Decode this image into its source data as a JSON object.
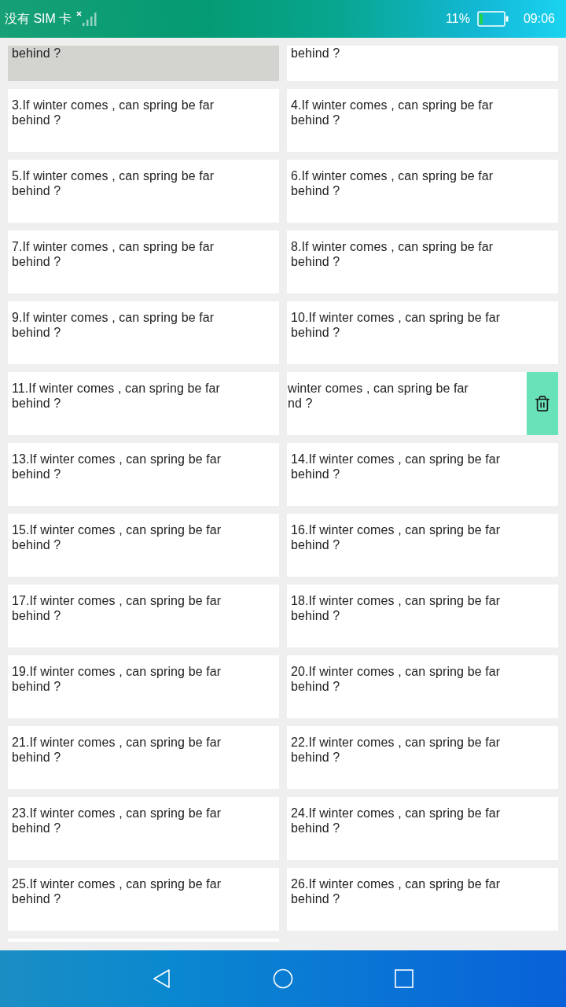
{
  "status_bar": {
    "carrier": "没有 SIM 卡",
    "battery": "11%",
    "time": "09:06"
  },
  "cards": [
    {
      "lines": [
        "behind ?"
      ],
      "selected": true,
      "swiped": false
    },
    {
      "lines": [
        "behind ?"
      ],
      "selected": false,
      "swiped": false
    },
    {
      "lines": [
        "3.If winter comes , can spring be far",
        "behind ?"
      ],
      "selected": false,
      "swiped": false
    },
    {
      "lines": [
        "4.If winter comes , can spring be far",
        "behind ?"
      ],
      "selected": false,
      "swiped": false
    },
    {
      "lines": [
        "5.If winter comes , can spring be far",
        "behind ?"
      ],
      "selected": false,
      "swiped": false
    },
    {
      "lines": [
        "6.If winter comes , can spring be far",
        "behind ?"
      ],
      "selected": false,
      "swiped": false
    },
    {
      "lines": [
        "7.If winter comes , can spring be far",
        "behind ?"
      ],
      "selected": false,
      "swiped": false
    },
    {
      "lines": [
        "8.If winter comes , can spring be far",
        "behind ?"
      ],
      "selected": false,
      "swiped": false
    },
    {
      "lines": [
        "9.If winter comes , can spring be far",
        "behind ?"
      ],
      "selected": false,
      "swiped": false
    },
    {
      "lines": [
        "10.If winter comes , can spring be far",
        "behind ?"
      ],
      "selected": false,
      "swiped": false
    },
    {
      "lines": [
        "11.If winter comes , can spring be far",
        "behind ?"
      ],
      "selected": false,
      "swiped": false
    },
    {
      "lines": [
        "winter comes , can spring be far",
        "nd ?"
      ],
      "selected": false,
      "swiped": true
    },
    {
      "lines": [
        "13.If winter comes , can spring be far",
        "behind ?"
      ],
      "selected": false,
      "swiped": false
    },
    {
      "lines": [
        "14.If winter comes , can spring be far",
        "behind ?"
      ],
      "selected": false,
      "swiped": false
    },
    {
      "lines": [
        "15.If winter comes , can spring be far",
        "behind ?"
      ],
      "selected": false,
      "swiped": false
    },
    {
      "lines": [
        "16.If winter comes , can spring be far",
        "behind ?"
      ],
      "selected": false,
      "swiped": false
    },
    {
      "lines": [
        "17.If winter comes , can spring be far",
        "behind ?"
      ],
      "selected": false,
      "swiped": false
    },
    {
      "lines": [
        "18.If winter comes , can spring be far",
        "behind ?"
      ],
      "selected": false,
      "swiped": false
    },
    {
      "lines": [
        "19.If winter comes , can spring be far",
        "behind ?"
      ],
      "selected": false,
      "swiped": false
    },
    {
      "lines": [
        "20.If winter comes , can spring be far",
        "behind ?"
      ],
      "selected": false,
      "swiped": false
    },
    {
      "lines": [
        "21.If winter comes , can spring be far",
        "behind ?"
      ],
      "selected": false,
      "swiped": false
    },
    {
      "lines": [
        "22.If winter comes , can spring be far",
        "behind ?"
      ],
      "selected": false,
      "swiped": false
    },
    {
      "lines": [
        "23.If winter comes , can spring be far",
        "behind ?"
      ],
      "selected": false,
      "swiped": false
    },
    {
      "lines": [
        "24.If winter comes , can spring be far",
        "behind ?"
      ],
      "selected": false,
      "swiped": false
    },
    {
      "lines": [
        "25.If winter comes , can spring be far",
        "behind ?"
      ],
      "selected": false,
      "swiped": false
    },
    {
      "lines": [
        "26.If winter comes , can spring be far",
        "behind ?"
      ],
      "selected": false,
      "swiped": false
    },
    {
      "selected": false,
      "swiped": false
    }
  ]
}
